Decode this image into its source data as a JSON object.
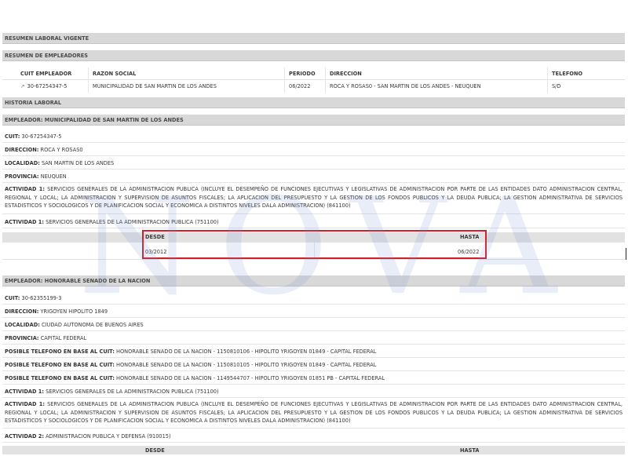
{
  "sections": {
    "resumen_laboral": "RESUMEN LABORAL VIGENTE",
    "resumen_empleadores": "RESUMEN DE EMPLEADORES",
    "historia_laboral": "HISTORIA LABORAL"
  },
  "summary_table": {
    "headers": [
      "CUIT EMPLEADOR",
      "RAZON SOCIAL",
      "PERIODO",
      "DIRECCION",
      "TELEFONO"
    ],
    "row": {
      "cuit": "30-67254347-5",
      "razon_social": "MUNICIPALIDAD DE SAN MARTIN DE LOS ANDES",
      "periodo": "06/2022",
      "direccion": "ROCA Y ROSAS0 - SAN MARTIN DE LOS ANDES - NEUQUEN",
      "telefono": "S/D"
    }
  },
  "employer1": {
    "title": "EMPLEADOR: MUNICIPALIDAD DE SAN MARTIN DE LOS ANDES",
    "cuit_label": "CUIT:",
    "cuit": "30-67254347-5",
    "direccion_label": "DIRECCION:",
    "direccion": "ROCA Y ROSAS0",
    "localidad_label": "LOCALIDAD:",
    "localidad": "SAN MARTIN DE LOS ANDES",
    "provincia_label": "PROVINCIA:",
    "provincia": "NEUQUEN",
    "actividad1_label": "ACTIVIDAD 1:",
    "actividad1": "SERVICIOS GENERALES DE LA ADMINISTRACION PUBLICA (INCLUYE EL DESEMPEÑO DE FUNCIONES EJECUTIVAS Y LEGISLATIVAS DE ADMINISTRACION POR PARTE DE LAS ENTIDADES DATO ADMINISTRACION CENTRAL, REGIONAL Y LOCAL; LA ADMINISTRACION Y SUPERVISION DE ASUNTOS FISCALES; LA APLICACION DEL PRESUPUESTO Y LA GESTION DE LOS FONDOS PUBLICOS Y LA DEUDA PUBLICA; LA GESTION ADMINISTRATIVA DE SERVICIOS ESTADISTICOS Y SOCIOLOGICOS Y DE PLANIFICACION SOCIAL Y ECONOMICA A DISTINTOS NIVELES DALA ADMINISTRACION) (841100)",
    "actividad1b_label": "ACTIVIDAD 1:",
    "actividad1b": "SERVICIOS GENERALES DE LA ADMINISTRACION PUBLICA (751100)",
    "desde_label": "DESDE",
    "hasta_label": "HASTA",
    "desde": "03/2012",
    "hasta": "06/2022"
  },
  "employer2": {
    "title": "EMPLEADOR: HONORABLE SENADO DE LA NACION",
    "cuit_label": "CUIT:",
    "cuit": "30-62355199-3",
    "direccion_label": "DIRECCION:",
    "direccion": "YRIGOYEN HIPOLITO 1849",
    "localidad_label": "LOCALIDAD:",
    "localidad": "CIUDAD AUTONOMA DE BUENOS AIRES",
    "provincia_label": "PROVINCIA:",
    "provincia": "CAPITAL FEDERAL",
    "tel_label": "POSIBLE TELEFONO EN BASE AL CUIT:",
    "tel1": "HONORABLE SENADO DE LA NACION - 1150810106 - HIPOLITO YRIGOYEN 01849 - CAPITAL FEDERAL",
    "tel2": "HONORABLE SENADO DE LA NACION - 1150810105 - HIPOLITO YRIGOYEN 01849 - CAPITAL FEDERAL",
    "tel3": "HONORABLE SENADO DE LA NACION - 1149544707 - HIPOLITO YRIGOYEN 01851 PB - CAPITAL FEDERAL",
    "actividad1_label": "ACTIVIDAD 1:",
    "actividad1": "SERVICIOS GENERALES DE LA ADMINISTRACION PUBLICA (751100)",
    "actividad1b_label": "ACTIVIDAD 1:",
    "actividad1b": "SERVICIOS GENERALES DE LA ADMINISTRACION PUBLICA (INCLUYE EL DESEMPEÑO DE FUNCIONES EJECUTIVAS Y LEGISLATIVAS DE ADMINISTRACION POR PARTE DE LAS ENTIDADES DATO ADMINISTRACION CENTRAL, REGIONAL Y LOCAL; LA ADMINISTRACION Y SUPERVISION DE ASUNTOS FISCALES; LA APLICACION DEL PRESUPUESTO Y LA GESTION DE LOS FONDOS PUBLICOS Y LA DEUDA PUBLICA; LA GESTION ADMINISTRATIVA DE SERVICIOS ESTADISTICOS Y SOCIOLOGICOS Y DE PLANIFICACION SOCIAL Y ECONOMICA A DISTINTOS NIVELES DALA ADMINISTRACION) (841100)",
    "actividad2_label": "ACTIVIDAD 2:",
    "actividad2": "ADMINISTRACION PUBLICA Y DEFENSA (910015)",
    "desde_label": "DESDE",
    "hasta_label": "HASTA"
  },
  "watermark": "NOVA",
  "colors": {
    "highlight_border": "#d01f2a",
    "header_bg": "#d8d8d8",
    "watermark": "#788ccd"
  }
}
